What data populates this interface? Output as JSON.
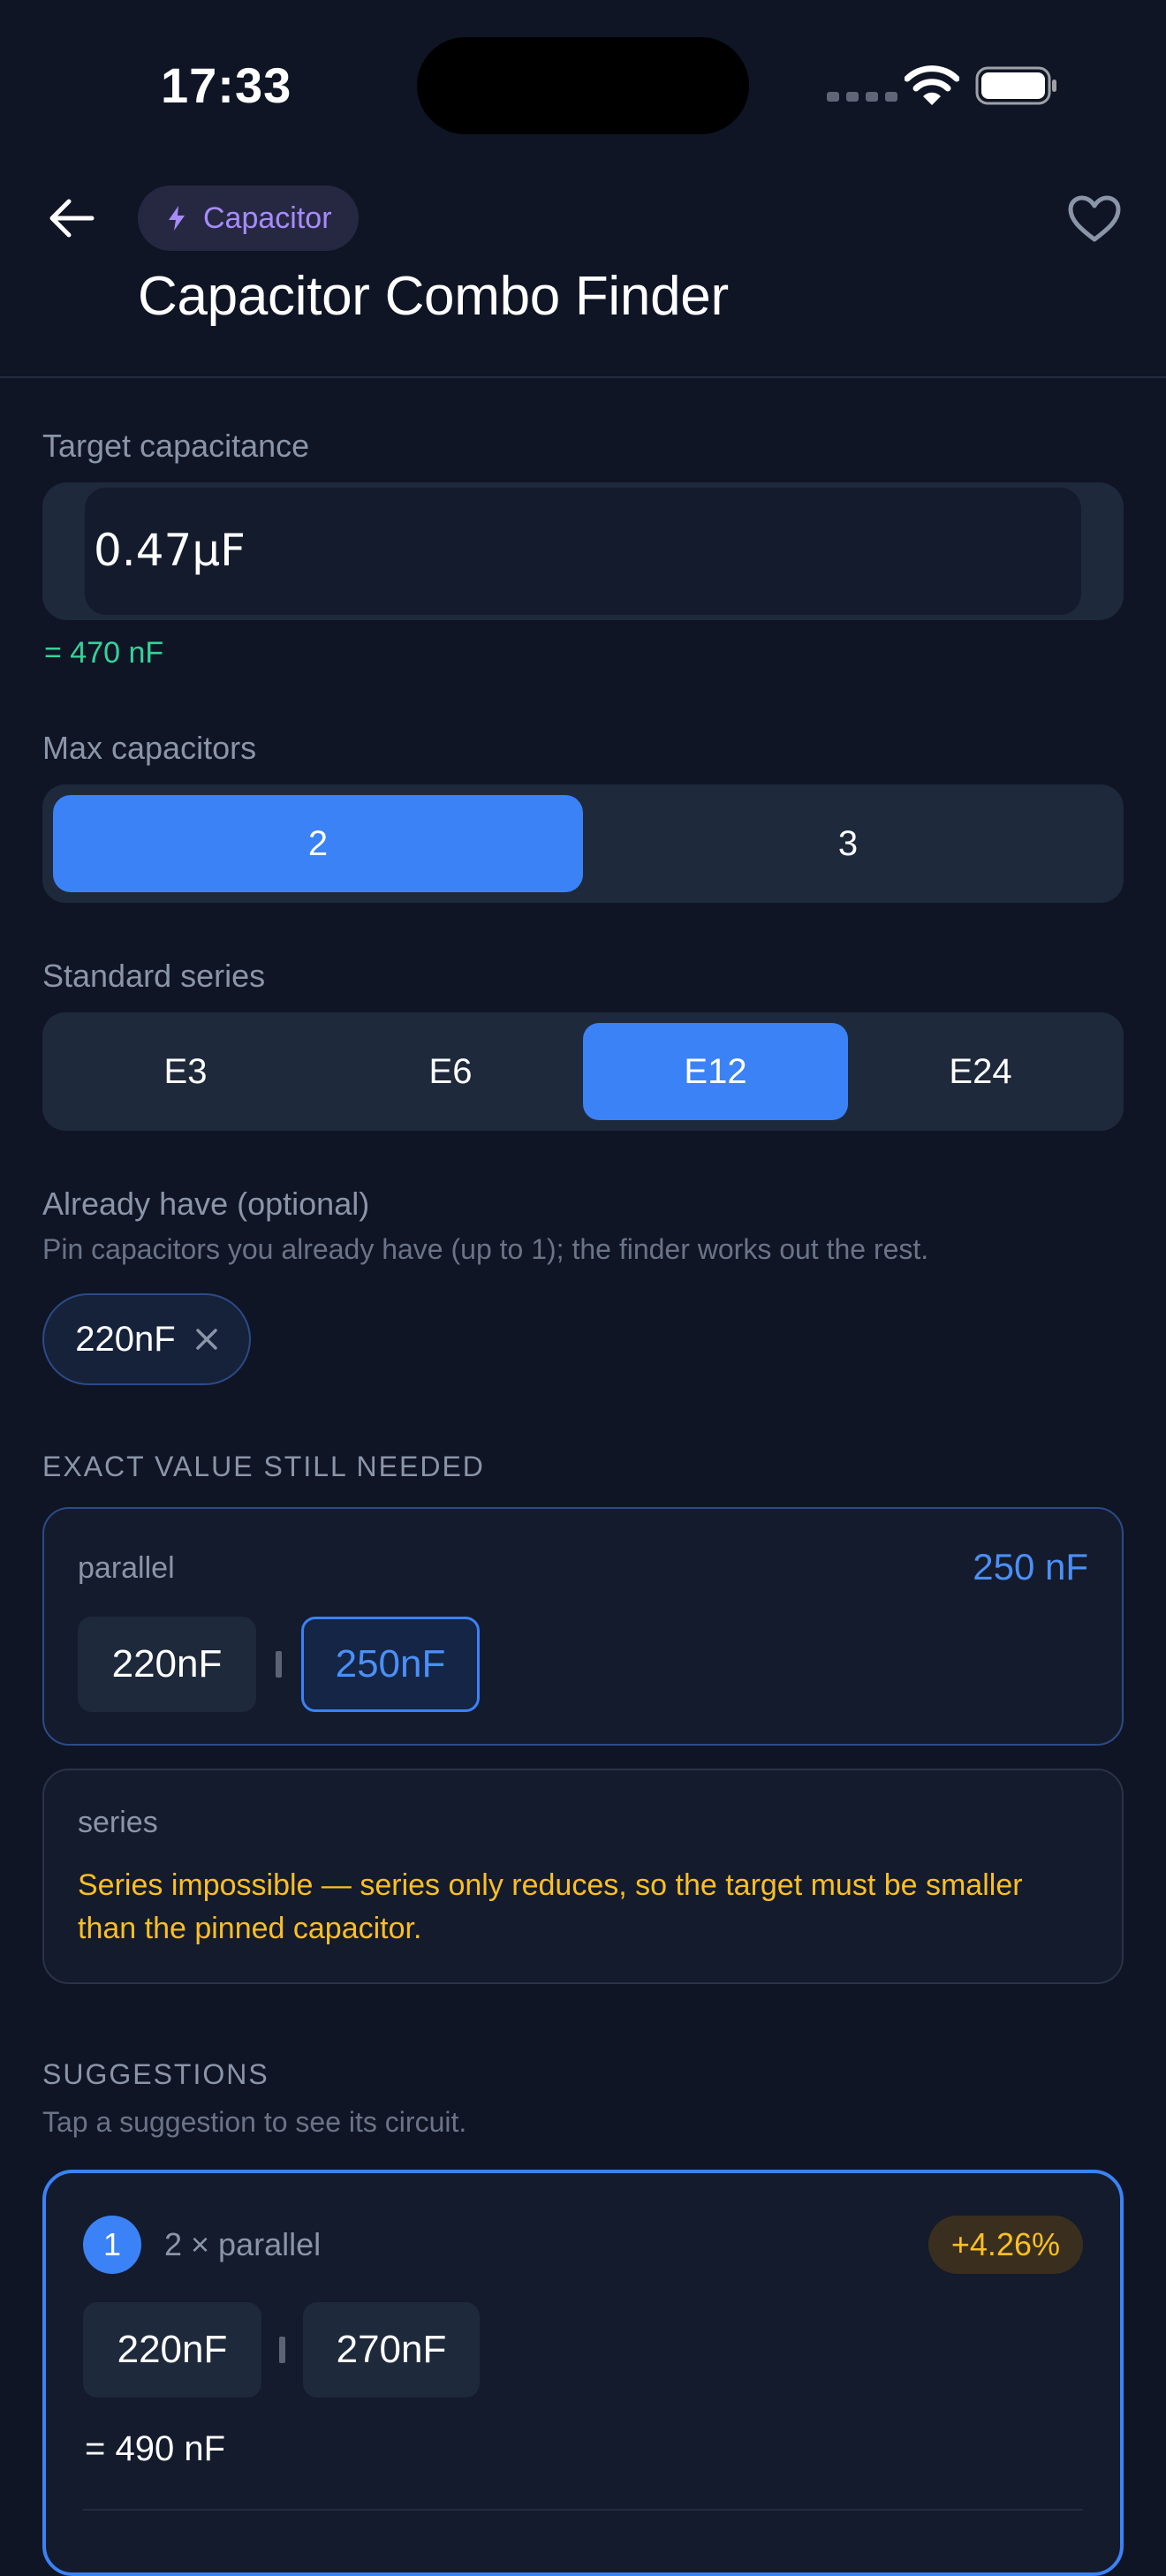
{
  "status_bar": {
    "time": "17:33"
  },
  "header": {
    "category": "Capacitor",
    "title": "Capacitor Combo Finder",
    "icons": {
      "back": "back-arrow-icon",
      "category": "bolt-icon",
      "favorite": "heart-icon"
    }
  },
  "target": {
    "label": "Target capacitance",
    "value": "0.47μF",
    "converted": "= 470 nF"
  },
  "max_capacitors": {
    "label": "Max capacitors",
    "options": [
      "2",
      "3"
    ],
    "selected": "2"
  },
  "standard_series": {
    "label": "Standard series",
    "options": [
      "E3",
      "E6",
      "E12",
      "E24"
    ],
    "selected": "E12"
  },
  "already_have": {
    "label": "Already have (optional)",
    "helper": "Pin capacitors you already have (up to 1); the finder works out the rest.",
    "pinned": [
      "220nF"
    ]
  },
  "exact": {
    "section_title": "EXACT VALUE STILL NEEDED",
    "parallel": {
      "tag": "parallel",
      "needed_value": "250 nF",
      "components": [
        "220nF",
        "250nF"
      ]
    },
    "series": {
      "tag": "series",
      "message": "Series impossible — series only reduces, so the target must be smaller than the pinned capacitor."
    }
  },
  "suggestions": {
    "section_title": "SUGGESTIONS",
    "helper": "Tap a suggestion to see its circuit.",
    "items": [
      {
        "rank": "1",
        "type": "2 × parallel",
        "error": "+4.26%",
        "components": [
          "220nF",
          "270nF"
        ],
        "result": "= 490 nF"
      }
    ]
  },
  "colors": {
    "background": "#0f1525",
    "accent": "#3b82f6",
    "category": "#a78bfa",
    "success": "#34d399",
    "warning": "#fbbf24"
  }
}
